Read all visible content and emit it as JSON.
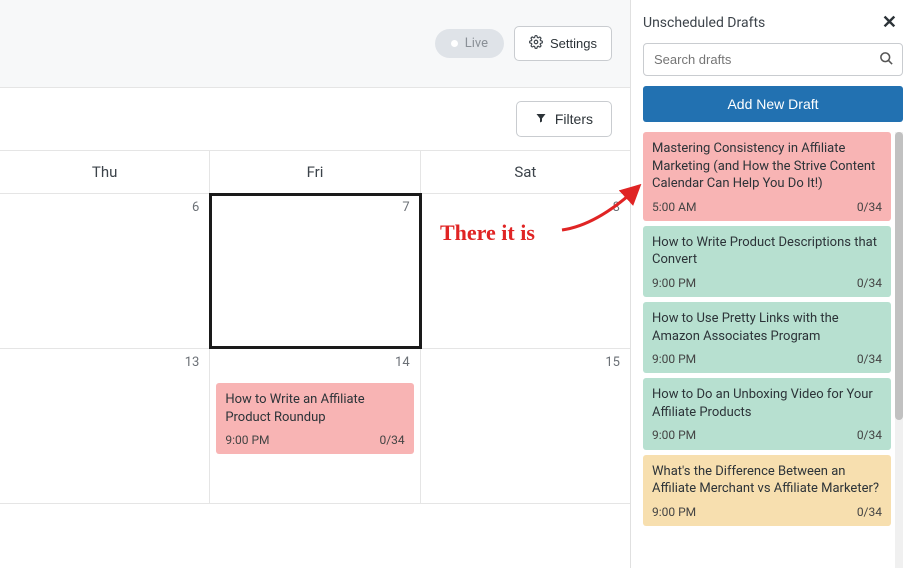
{
  "topbar": {
    "live_label": "Live",
    "settings_label": "Settings"
  },
  "filters": {
    "label": "Filters"
  },
  "calendar": {
    "headers": [
      "Thu",
      "Fri",
      "Sat"
    ],
    "rows": [
      {
        "days": [
          "6",
          "7",
          "8"
        ],
        "focus_index": 1
      },
      {
        "days": [
          "13",
          "14",
          "15"
        ]
      }
    ],
    "event": {
      "title": "How to Write an Affiliate Product Roundup",
      "time": "9:00 PM",
      "progress": "0/34"
    }
  },
  "annotation": {
    "text": "There it is"
  },
  "sidebar": {
    "title": "Unscheduled Drafts",
    "search_placeholder": "Search drafts",
    "add_label": "Add New Draft",
    "drafts": [
      {
        "title": "Mastering Consistency in Affiliate Marketing (and How the Strive Content Calendar Can Help You Do It!)",
        "time": "5:00 AM",
        "progress": "0/34",
        "color": "c-red"
      },
      {
        "title": "How to Write Product Descriptions that Convert",
        "time": "9:00 PM",
        "progress": "0/34",
        "color": "c-green"
      },
      {
        "title": "How to Use Pretty Links with the Amazon Associates Program",
        "time": "9:00 PM",
        "progress": "0/34",
        "color": "c-green"
      },
      {
        "title": "How to Do an Unboxing Video for Your Affiliate Products",
        "time": "9:00 PM",
        "progress": "0/34",
        "color": "c-green"
      },
      {
        "title": "What's the Difference Between an Affiliate Merchant vs Affiliate Marketer?",
        "time": "9:00 PM",
        "progress": "0/34",
        "color": "c-orange"
      }
    ]
  }
}
